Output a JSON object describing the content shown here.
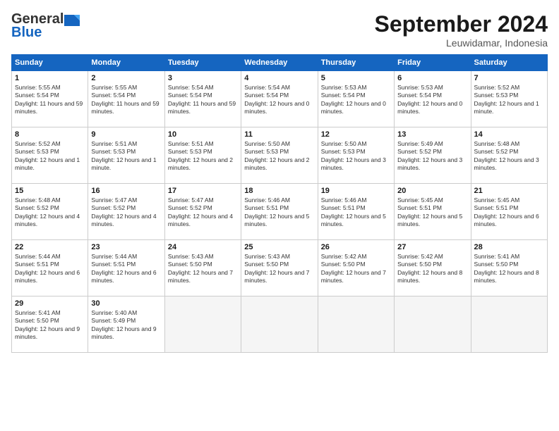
{
  "header": {
    "logo_general": "General",
    "logo_blue": "Blue",
    "month": "September 2024",
    "location": "Leuwidamar, Indonesia"
  },
  "weekdays": [
    "Sunday",
    "Monday",
    "Tuesday",
    "Wednesday",
    "Thursday",
    "Friday",
    "Saturday"
  ],
  "weeks": [
    [
      {
        "day": "1",
        "info": "Sunrise: 5:55 AM\nSunset: 5:54 PM\nDaylight: 11 hours and 59 minutes."
      },
      {
        "day": "2",
        "info": "Sunrise: 5:55 AM\nSunset: 5:54 PM\nDaylight: 11 hours and 59 minutes."
      },
      {
        "day": "3",
        "info": "Sunrise: 5:54 AM\nSunset: 5:54 PM\nDaylight: 11 hours and 59 minutes."
      },
      {
        "day": "4",
        "info": "Sunrise: 5:54 AM\nSunset: 5:54 PM\nDaylight: 12 hours and 0 minutes."
      },
      {
        "day": "5",
        "info": "Sunrise: 5:53 AM\nSunset: 5:54 PM\nDaylight: 12 hours and 0 minutes."
      },
      {
        "day": "6",
        "info": "Sunrise: 5:53 AM\nSunset: 5:54 PM\nDaylight: 12 hours and 0 minutes."
      },
      {
        "day": "7",
        "info": "Sunrise: 5:52 AM\nSunset: 5:53 PM\nDaylight: 12 hours and 1 minute."
      }
    ],
    [
      {
        "day": "8",
        "info": "Sunrise: 5:52 AM\nSunset: 5:53 PM\nDaylight: 12 hours and 1 minute."
      },
      {
        "day": "9",
        "info": "Sunrise: 5:51 AM\nSunset: 5:53 PM\nDaylight: 12 hours and 1 minute."
      },
      {
        "day": "10",
        "info": "Sunrise: 5:51 AM\nSunset: 5:53 PM\nDaylight: 12 hours and 2 minutes."
      },
      {
        "day": "11",
        "info": "Sunrise: 5:50 AM\nSunset: 5:53 PM\nDaylight: 12 hours and 2 minutes."
      },
      {
        "day": "12",
        "info": "Sunrise: 5:50 AM\nSunset: 5:53 PM\nDaylight: 12 hours and 3 minutes."
      },
      {
        "day": "13",
        "info": "Sunrise: 5:49 AM\nSunset: 5:52 PM\nDaylight: 12 hours and 3 minutes."
      },
      {
        "day": "14",
        "info": "Sunrise: 5:48 AM\nSunset: 5:52 PM\nDaylight: 12 hours and 3 minutes."
      }
    ],
    [
      {
        "day": "15",
        "info": "Sunrise: 5:48 AM\nSunset: 5:52 PM\nDaylight: 12 hours and 4 minutes."
      },
      {
        "day": "16",
        "info": "Sunrise: 5:47 AM\nSunset: 5:52 PM\nDaylight: 12 hours and 4 minutes."
      },
      {
        "day": "17",
        "info": "Sunrise: 5:47 AM\nSunset: 5:52 PM\nDaylight: 12 hours and 4 minutes."
      },
      {
        "day": "18",
        "info": "Sunrise: 5:46 AM\nSunset: 5:51 PM\nDaylight: 12 hours and 5 minutes."
      },
      {
        "day": "19",
        "info": "Sunrise: 5:46 AM\nSunset: 5:51 PM\nDaylight: 12 hours and 5 minutes."
      },
      {
        "day": "20",
        "info": "Sunrise: 5:45 AM\nSunset: 5:51 PM\nDaylight: 12 hours and 5 minutes."
      },
      {
        "day": "21",
        "info": "Sunrise: 5:45 AM\nSunset: 5:51 PM\nDaylight: 12 hours and 6 minutes."
      }
    ],
    [
      {
        "day": "22",
        "info": "Sunrise: 5:44 AM\nSunset: 5:51 PM\nDaylight: 12 hours and 6 minutes."
      },
      {
        "day": "23",
        "info": "Sunrise: 5:44 AM\nSunset: 5:51 PM\nDaylight: 12 hours and 6 minutes."
      },
      {
        "day": "24",
        "info": "Sunrise: 5:43 AM\nSunset: 5:50 PM\nDaylight: 12 hours and 7 minutes."
      },
      {
        "day": "25",
        "info": "Sunrise: 5:43 AM\nSunset: 5:50 PM\nDaylight: 12 hours and 7 minutes."
      },
      {
        "day": "26",
        "info": "Sunrise: 5:42 AM\nSunset: 5:50 PM\nDaylight: 12 hours and 7 minutes."
      },
      {
        "day": "27",
        "info": "Sunrise: 5:42 AM\nSunset: 5:50 PM\nDaylight: 12 hours and 8 minutes."
      },
      {
        "day": "28",
        "info": "Sunrise: 5:41 AM\nSunset: 5:50 PM\nDaylight: 12 hours and 8 minutes."
      }
    ],
    [
      {
        "day": "29",
        "info": "Sunrise: 5:41 AM\nSunset: 5:50 PM\nDaylight: 12 hours and 9 minutes."
      },
      {
        "day": "30",
        "info": "Sunrise: 5:40 AM\nSunset: 5:49 PM\nDaylight: 12 hours and 9 minutes."
      },
      {
        "day": "",
        "info": ""
      },
      {
        "day": "",
        "info": ""
      },
      {
        "day": "",
        "info": ""
      },
      {
        "day": "",
        "info": ""
      },
      {
        "day": "",
        "info": ""
      }
    ]
  ]
}
